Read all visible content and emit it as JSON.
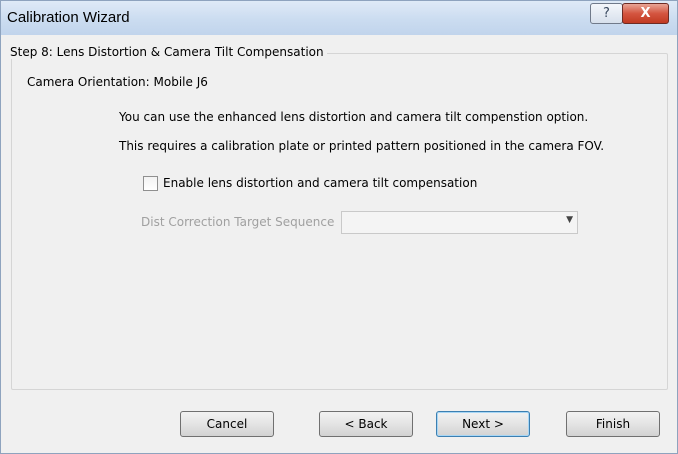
{
  "window": {
    "title": "Calibration Wizard",
    "help_glyph": "?",
    "close_glyph": "X"
  },
  "step": {
    "heading": "Step 8: Lens Distortion & Camera Tilt Compensation",
    "orientation": "Camera Orientation: Mobile J6",
    "info1": "You can use the enhanced lens distortion and camera tilt compenstion option.",
    "info2": "This requires a calibration plate or printed pattern positioned in the camera FOV.",
    "checkbox_label": "Enable lens distortion and camera tilt compensation",
    "checkbox_checked": false,
    "dist_label": "Dist Correction Target Sequence",
    "dist_value": ""
  },
  "buttons": {
    "cancel": "Cancel",
    "back": "< Back",
    "next": "Next >",
    "finish": "Finish"
  }
}
